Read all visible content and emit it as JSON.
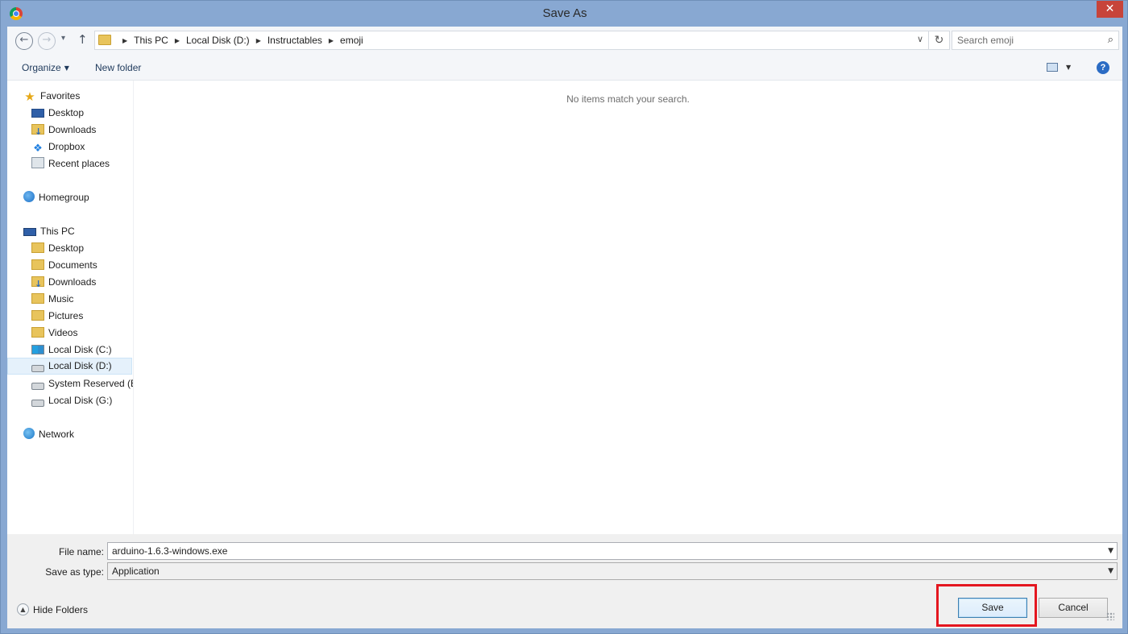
{
  "window": {
    "title": "Save As",
    "close_glyph": "✕"
  },
  "nav": {
    "back_glyph": "←",
    "forward_glyph": "→",
    "recent_glyph": "▾",
    "up_glyph": "↑",
    "breadcrumbs": [
      "This PC",
      "Local Disk (D:)",
      "Instructables",
      "emoji"
    ],
    "breadcrumb_sep": "▶",
    "address_dropdown_glyph": "∨",
    "refresh_glyph": "↻",
    "search_placeholder": "Search emoji",
    "search_glyph": "⌕"
  },
  "toolbar": {
    "organize_label": "Organize",
    "organize_caret": "▼",
    "new_folder_label": "New folder",
    "view_caret": "▼",
    "help_glyph": "?"
  },
  "navpane": {
    "favorites": {
      "label": "Favorites",
      "items": [
        "Desktop",
        "Downloads",
        "Dropbox",
        "Recent places"
      ]
    },
    "homegroup": {
      "label": "Homegroup"
    },
    "this_pc": {
      "label": "This PC",
      "items": [
        "Desktop",
        "Documents",
        "Downloads",
        "Music",
        "Pictures",
        "Videos",
        "Local Disk (C:)",
        "Local Disk (D:)",
        "System Reserved (E:)",
        "Local Disk (G:)"
      ],
      "selected": "Local Disk (D:)"
    },
    "network": {
      "label": "Network"
    },
    "star_glyph": "★",
    "dropbox_glyph": "❖",
    "expander_glyph": "▸"
  },
  "content": {
    "empty_message": "No items match your search."
  },
  "form": {
    "file_name_label": "File name:",
    "file_name_value": "arduino-1.6.3-windows.exe",
    "save_type_label": "Save as type:",
    "save_type_value": "Application",
    "combo_caret": "▼",
    "hide_folders_label": "Hide Folders",
    "hide_folders_glyph": "▲",
    "save_label": "Save",
    "cancel_label": "Cancel"
  },
  "colors": {
    "highlight": "#e4161f",
    "title_bar": "#88a8d2",
    "close_button": "#c7443a"
  }
}
